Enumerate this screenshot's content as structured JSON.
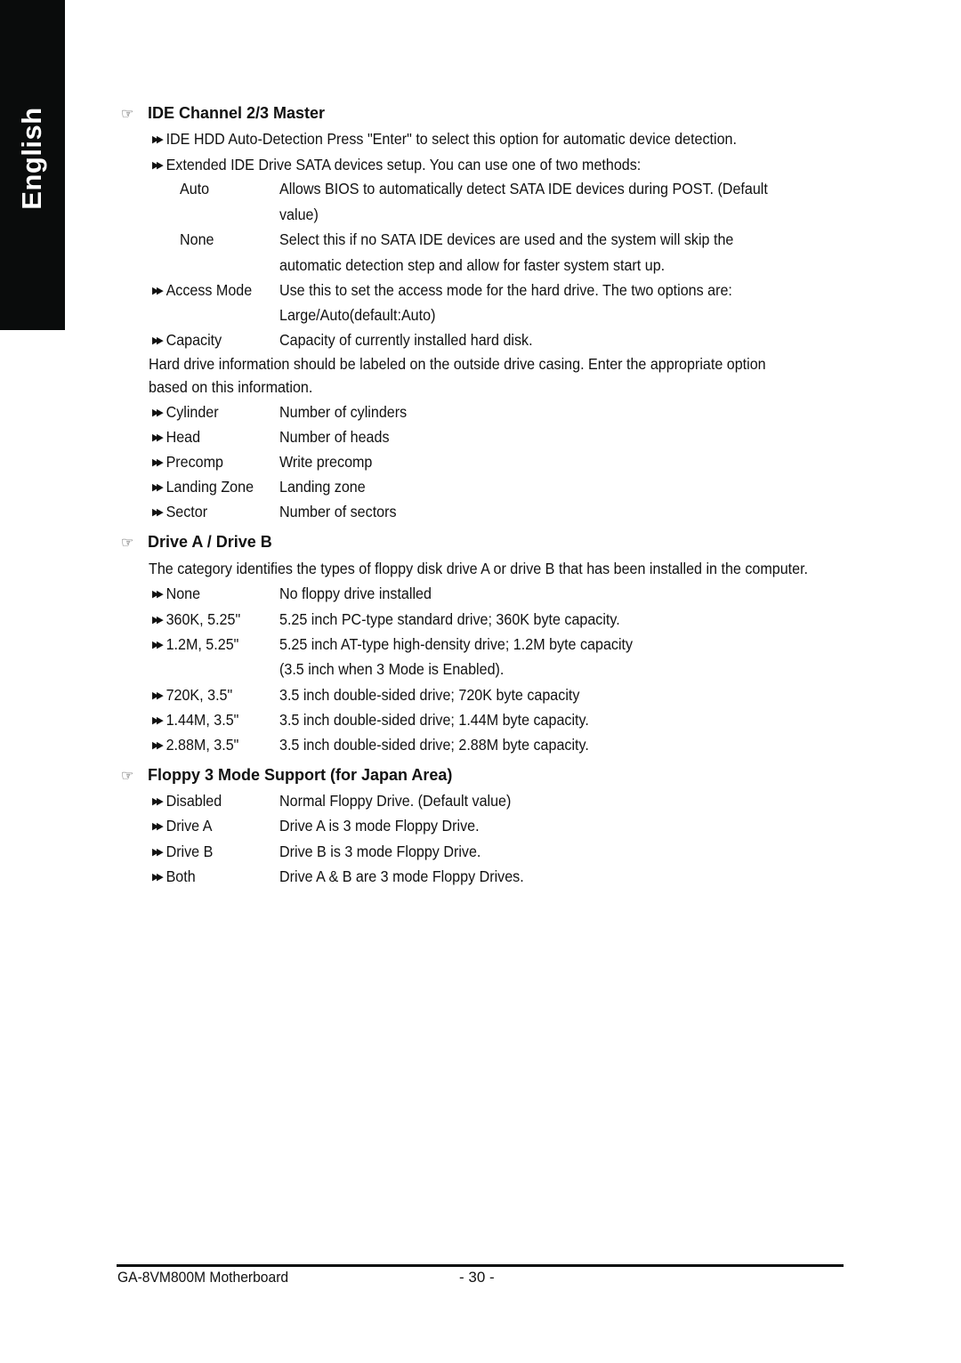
{
  "side_tab": {
    "label": "English"
  },
  "sections": {
    "ide": {
      "title": "IDE Channel 2/3 Master",
      "bullets": [
        "IDE HDD Auto-Detection Press \"Enter\" to select this option for automatic device detection.",
        "Extended IDE Drive SATA devices setup. You can use one of two methods:"
      ],
      "methods": [
        {
          "label": "Auto",
          "desc1": "Allows BIOS to automatically detect SATA IDE devices during POST. (Default",
          "desc2": "value)"
        },
        {
          "label": "None",
          "desc1": "Select this if no SATA IDE devices are used and the system will skip the",
          "desc2": "automatic detection step and allow for faster system start up."
        }
      ],
      "access_mode": {
        "label": "Access Mode",
        "desc1": "Use this to set the access mode for the hard drive. The two options are:",
        "desc2": "Large/Auto(default:Auto)"
      },
      "capacity": {
        "label": "Capacity",
        "desc": "Capacity of currently installed hard disk."
      },
      "note1": "Hard drive information should be labeled on the outside drive casing.  Enter the appropriate option",
      "note2": "based on this information.",
      "params": [
        {
          "label": "Cylinder",
          "desc": "Number of cylinders"
        },
        {
          "label": "Head",
          "desc": "Number of heads"
        },
        {
          "label": "Precomp",
          "desc": "Write precomp"
        },
        {
          "label": "Landing Zone",
          "desc": "Landing zone"
        },
        {
          "label": "Sector",
          "desc": "Number of sectors"
        }
      ]
    },
    "drive": {
      "title": "Drive A / Drive B",
      "intro": "The category identifies the types of floppy disk drive A or drive B that has been installed in the computer.",
      "options": [
        {
          "label": "None",
          "desc": "No floppy drive installed"
        },
        {
          "label": "360K, 5.25\"",
          "desc": "5.25 inch PC-type standard drive; 360K byte capacity."
        },
        {
          "label": "1.2M, 5.25\"",
          "desc": "5.25 inch AT-type high-density drive; 1.2M byte capacity",
          "desc2": "(3.5 inch when 3 Mode is Enabled)."
        },
        {
          "label": "720K, 3.5\"",
          "desc": "3.5 inch double-sided drive; 720K byte capacity"
        },
        {
          "label": "1.44M, 3.5\"",
          "desc": "3.5 inch double-sided drive; 1.44M byte capacity."
        },
        {
          "label": "2.88M, 3.5\"",
          "desc": "3.5 inch double-sided drive; 2.88M byte capacity."
        }
      ]
    },
    "floppy3": {
      "title": "Floppy 3 Mode Support (for Japan Area)",
      "options": [
        {
          "label": "Disabled",
          "desc": "Normal Floppy Drive. (Default value)"
        },
        {
          "label": "Drive A",
          "desc": "Drive A is 3 mode Floppy Drive."
        },
        {
          "label": "Drive B",
          "desc": "Drive B is 3 mode Floppy Drive."
        },
        {
          "label": "Both",
          "desc": "Drive A & B are 3 mode Floppy Drives."
        }
      ]
    }
  },
  "icons": {
    "hand": "☞",
    "arrow": "▶▶"
  },
  "footer": {
    "model": "GA-8VM800M Motherboard",
    "page": "- 30 -"
  }
}
